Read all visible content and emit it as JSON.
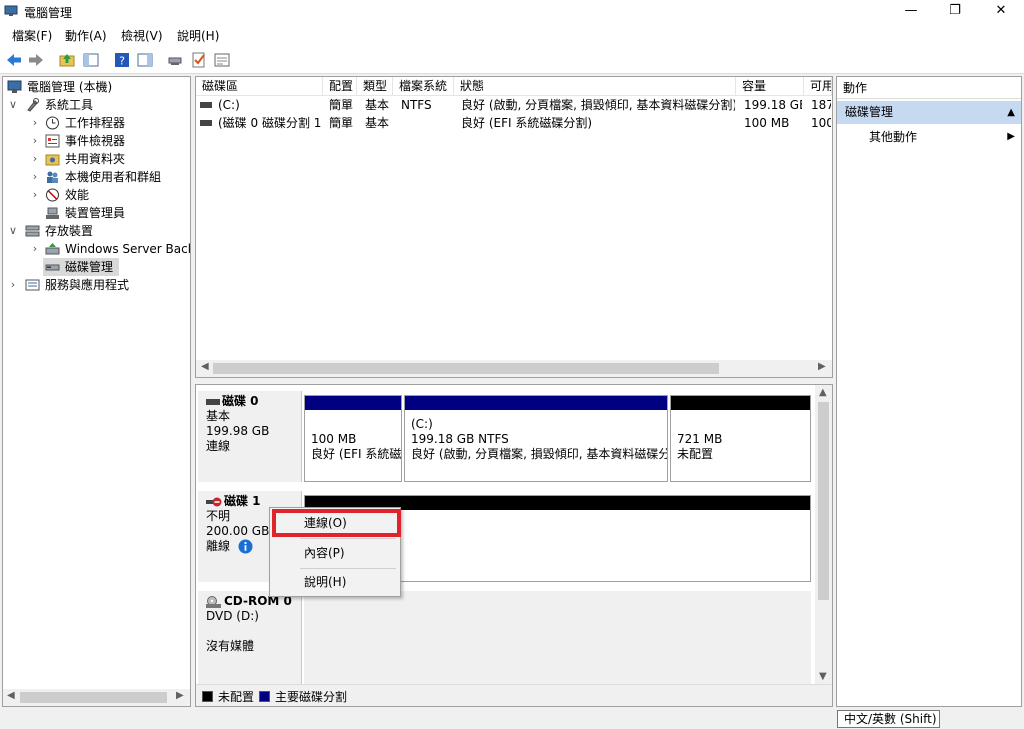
{
  "window": {
    "title": "電腦管理",
    "minimize": "—",
    "maximize": "❐",
    "close": "✕"
  },
  "menu": [
    "檔案(F)",
    "動作(A)",
    "檢視(V)",
    "說明(H)"
  ],
  "tree": [
    {
      "label": "電腦管理 (本機)",
      "chev": "",
      "level": 0,
      "icon": "computer-management-icon"
    },
    {
      "label": "系統工具",
      "chev": "∨",
      "level": 1,
      "icon": "system-tools-icon"
    },
    {
      "label": "工作排程器",
      "chev": "›",
      "level": 2,
      "icon": "clock-icon"
    },
    {
      "label": "事件檢視器",
      "chev": "›",
      "level": 2,
      "icon": "event-viewer-icon"
    },
    {
      "label": "共用資料夾",
      "chev": "›",
      "level": 2,
      "icon": "shared-folder-icon"
    },
    {
      "label": "本機使用者和群組",
      "chev": "›",
      "level": 2,
      "icon": "users-icon"
    },
    {
      "label": "效能",
      "chev": "›",
      "level": 2,
      "icon": "performance-icon"
    },
    {
      "label": "裝置管理員",
      "chev": "",
      "level": 2,
      "icon": "device-manager-icon"
    },
    {
      "label": "存放裝置",
      "chev": "∨",
      "level": 1,
      "icon": "storage-icon"
    },
    {
      "label": "Windows Server Backup",
      "chev": "›",
      "level": 2,
      "icon": "backup-icon"
    },
    {
      "label": "磁碟管理",
      "chev": "",
      "level": 2,
      "icon": "disk-management-icon",
      "selected": true
    },
    {
      "label": "服務與應用程式",
      "chev": "›",
      "level": 1,
      "icon": "services-icon"
    }
  ],
  "volume_table": {
    "headers": [
      "磁碟區",
      "配置",
      "類型",
      "檔案系統",
      "狀態",
      "容量",
      "可用"
    ],
    "rows": [
      [
        "(C:)",
        "簡單",
        "基本",
        "NTFS",
        "良好 (啟動, 分頁檔案, 損毀傾印, 基本資料磁碟分割)",
        "199.18 GB",
        "187"
      ],
      [
        "(磁碟 0 磁碟分割 1)",
        "簡單",
        "基本",
        "",
        "良好 (EFI 系統磁碟分割)",
        "100 MB",
        "100"
      ]
    ]
  },
  "disks": [
    {
      "name": "磁碟 0",
      "type": "基本",
      "size": "199.98 GB",
      "status": "連線",
      "partitions": [
        {
          "line1": "",
          "line2": "100 MB",
          "line3": "良好 (EFI 系統磁碟分割)",
          "bar": "#000080"
        },
        {
          "line1": "(C:)",
          "line2": "199.18 GB NTFS",
          "line3": "良好 (啟動, 分頁檔案, 損毀傾印, 基本資料磁碟分割)",
          "bar": "#000080"
        },
        {
          "line1": "",
          "line2": "721 MB",
          "line3": "未配置",
          "bar": "#000000"
        }
      ]
    },
    {
      "name": "磁碟 1",
      "type": "不明",
      "size": "200.00 GB",
      "status": "離線"
    },
    {
      "name": "CD-ROM 0",
      "type": "DVD (D:)",
      "size": "",
      "status": "沒有媒體"
    }
  ],
  "context_menu": [
    "連線(O)",
    "內容(P)",
    "說明(H)"
  ],
  "legend": [
    {
      "label": "未配置",
      "color": "#000000"
    },
    {
      "label": "主要磁碟分割",
      "color": "#000080"
    }
  ],
  "actions": {
    "header": "動作",
    "section": "磁碟管理",
    "item": "其他動作"
  },
  "statusbar": {
    "ime": "中文/英數 (Shift)"
  }
}
